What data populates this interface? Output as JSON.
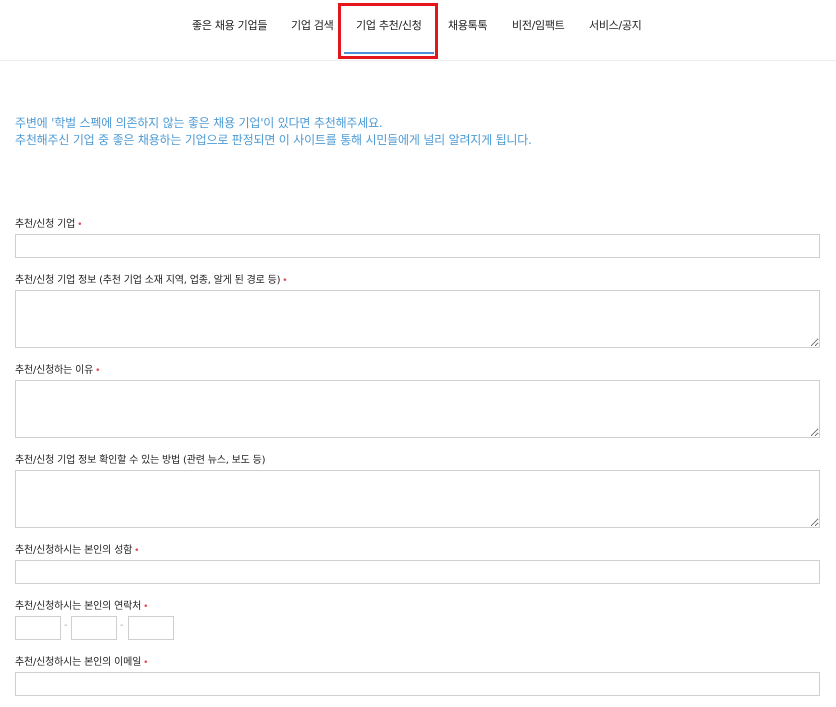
{
  "nav": {
    "items": [
      {
        "label": "좋은 채용 기업들"
      },
      {
        "label": "기업 검색"
      },
      {
        "label": "기업 추천/신청"
      },
      {
        "label": "채용톡톡"
      },
      {
        "label": "비전/임팩트"
      },
      {
        "label": "서비스/공지"
      }
    ],
    "active_index": 2,
    "accent_color": "#4a90d9",
    "highlight_color": "#e4161b"
  },
  "intro": {
    "line1": "주변에 '학벌 스펙에 의존하지 않는 좋은 채용 기업'이 있다면 추천해주세요.",
    "line2": "추천해주신 기업 중 좋은 채용하는 기업으로 판정되면 이 사이트를 통해 시민들에게 널리 알려지게 됩니다.",
    "color": "#4d9bd6"
  },
  "form": {
    "required_mark": "•",
    "company": {
      "label": "추천/신청 기업"
    },
    "company_info": {
      "label": "추천/신청 기업 정보 (추천 기업 소재 지역, 업종, 알게 된 경로 등)"
    },
    "reason": {
      "label": "추천/신청하는 이유"
    },
    "verify_method": {
      "label": "추천/신청 기업 정보 확인할 수 있는 방법 (관련 뉴스, 보도 등)"
    },
    "name": {
      "label": "추천/신청하시는 본인의 성함"
    },
    "phone": {
      "label": "추천/신청하시는 본인의 연락처",
      "separator": "-"
    },
    "email": {
      "label": "추천/신청하시는 본인의 이메일"
    }
  }
}
